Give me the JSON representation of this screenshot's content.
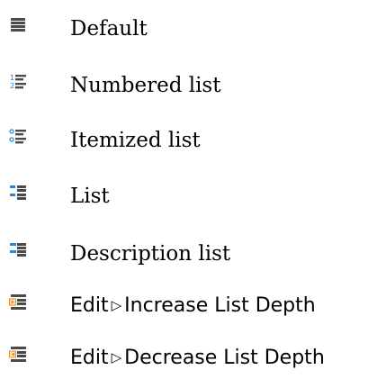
{
  "menu": {
    "items": [
      {
        "label": "Default",
        "icon": "default-list-icon"
      },
      {
        "label": "Numbered list",
        "icon": "numbered-list-icon"
      },
      {
        "label": "Itemized list",
        "icon": "itemized-list-icon"
      },
      {
        "label": "List",
        "icon": "list-icon"
      },
      {
        "label": "Description list",
        "icon": "description-list-icon"
      }
    ],
    "commands": [
      {
        "menu": "Edit",
        "separator": "▷",
        "action": "Increase List Depth",
        "icon": "increase-list-depth-icon"
      },
      {
        "menu": "Edit",
        "separator": "▷",
        "action": "Decrease List Depth",
        "icon": "decrease-list-depth-icon"
      }
    ]
  },
  "colors": {
    "line": "#4a4a4a",
    "number": "#2f6fcf",
    "bullet": "#2a8ad9",
    "orange": "#f08a1e",
    "text": "#000000"
  }
}
